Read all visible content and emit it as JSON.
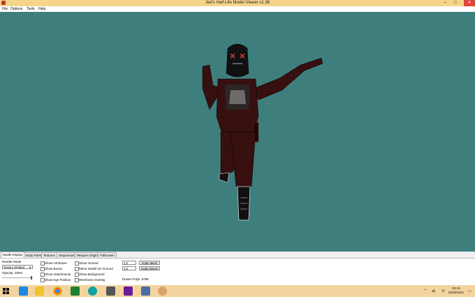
{
  "window": {
    "title": "Jed's Half-Life Model Viewer v1.36",
    "minimize": "–",
    "maximize": "□",
    "close": "✕"
  },
  "menu": [
    "File",
    "Options",
    "Tools",
    "Help"
  ],
  "tabs": [
    "Model Display",
    "Body Parts",
    "Textures",
    "Sequences",
    "Weapon Origin",
    "Fullscreen"
  ],
  "panel": {
    "render_mode_label": "Render Mode",
    "render_mode_value": "Texture Shaded",
    "opacity_label": "Opacity: 100%",
    "col1": [
      "Show Hit Boxes",
      "Show Bones",
      "Show Attachments",
      "Show Eye Position"
    ],
    "col2": [
      "Show Ground",
      "Mirror Model On Ground",
      "Show Background",
      "Wireframe Overlay"
    ],
    "mesh_scale": "1.0",
    "bone_scale": "1.0",
    "scale_mesh_btn": "Scale Mesh",
    "scale_bones_btn": "Scale Bones",
    "drawn_polys": "Drawn Polys: 6799"
  },
  "taskbar": {
    "time": "00:19",
    "date": "20/08/2021"
  },
  "colors": {
    "viewport_bg": "#3e7f7e",
    "titlebar": "#f5d58a",
    "taskbar": "#f3d49e"
  }
}
